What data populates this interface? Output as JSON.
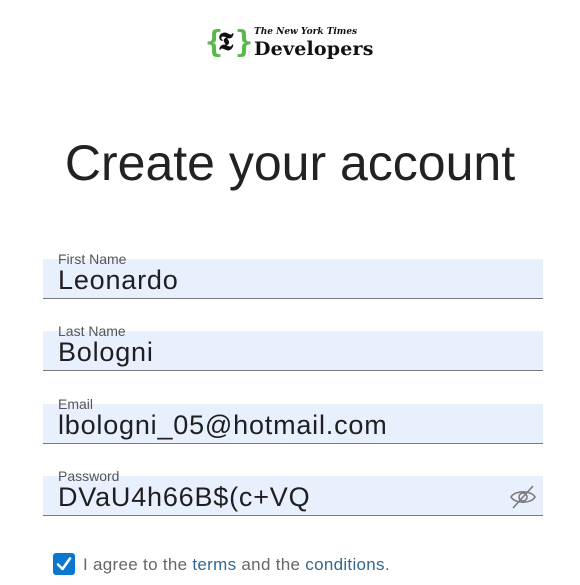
{
  "logo": {
    "brand_name": "The New York Times",
    "product_name": "Developers"
  },
  "title": "Create your account",
  "form": {
    "first_name": {
      "label": "First Name",
      "value": "Leonardo"
    },
    "last_name": {
      "label": "Last Name",
      "value": "Bologni"
    },
    "email": {
      "label": "Email",
      "value": "lbologni_05@hotmail.com"
    },
    "password": {
      "label": "Password",
      "value": "DVaU4h66B$(c+VQ",
      "toggle_icon": "eye-slash-icon"
    }
  },
  "agreement": {
    "checked": true,
    "text_before": "I agree to the ",
    "terms_link": "terms",
    "text_middle": " and the ",
    "conditions_link": "conditions",
    "text_after": "."
  },
  "colors": {
    "field_background": "#e8f0fe",
    "checkbox": "#0b78d0",
    "link": "#326891",
    "logo_brace": "#58b94a"
  }
}
